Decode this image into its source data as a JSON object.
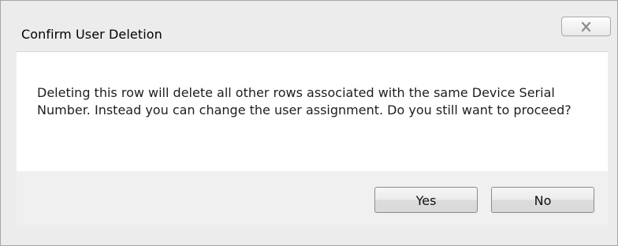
{
  "dialog": {
    "title": "Confirm User Deletion",
    "close_icon": "close-icon",
    "message": "Deleting this row will delete all other rows associated with the same Device Serial Number. Instead you can change the user assignment. Do you still want to proceed?",
    "buttons": {
      "yes_label": "Yes",
      "no_label": "No"
    }
  }
}
